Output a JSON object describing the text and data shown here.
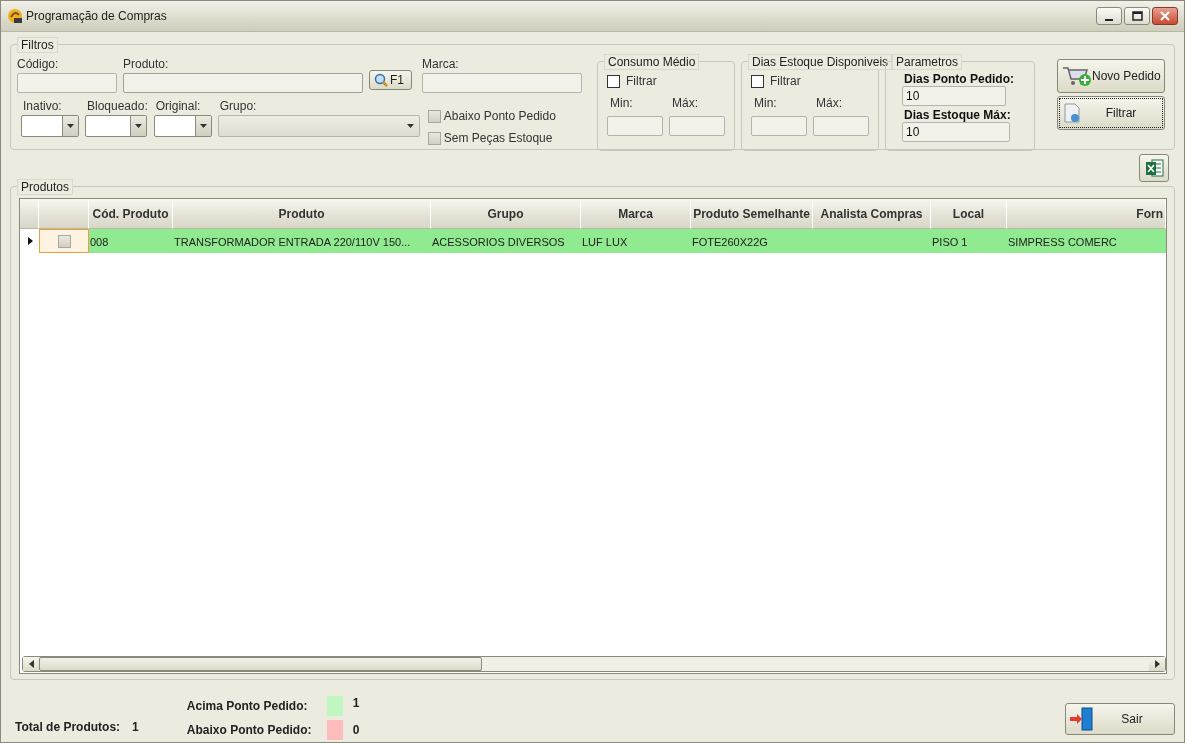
{
  "window": {
    "title": "Programação de Compras"
  },
  "filters": {
    "title": "Filtros",
    "text_fields": [
      {
        "label": "Código:"
      },
      {
        "label": "Produto:"
      },
      {
        "label": "Marca:"
      }
    ],
    "lookup_button": "F1",
    "combos": [
      {
        "label": "Inativo:"
      },
      {
        "label": "Bloqueado:"
      },
      {
        "label": "Original:"
      },
      {
        "label": "Grupo:"
      }
    ],
    "checkboxes": [
      {
        "label": "Abaixo Ponto Pedido",
        "checked": false
      },
      {
        "label": "Sem Peças Estoque",
        "checked": false
      }
    ]
  },
  "ranges": [
    {
      "title": "Consumo Médio",
      "filter_label": "Filtrar",
      "checked": false,
      "min_label": "Min:",
      "max_label": "Máx:"
    },
    {
      "title": "Dias Estoque Disponiveis",
      "filter_label": "Filtrar",
      "checked": false,
      "min_label": "Min:",
      "max_label": "Máx:"
    }
  ],
  "parametros": {
    "title": "Parametros",
    "fields": [
      {
        "label": "Dias Ponto Pedido:",
        "value": "10"
      },
      {
        "label": "Dias Estoque Máx:",
        "value": "10"
      }
    ]
  },
  "actions": [
    {
      "kind": "new",
      "label": "Novo Pedido"
    },
    {
      "kind": "filter",
      "label": "Filtrar"
    }
  ],
  "products": {
    "title": "Produtos",
    "columns": [
      "Cód. Produto",
      "Produto",
      "Grupo",
      "Marca",
      "Produto Semelhante",
      "Analista Compras",
      "Local",
      "Forn"
    ],
    "rows": [
      {
        "selected": true,
        "checked": false,
        "color": "#90ea90",
        "cells": [
          "008",
          "TRANSFORMADOR  ENTRADA  220/110V  150...",
          "ACESSORIOS DIVERSOS",
          "LUF LUX",
          "FOTE260X22G",
          null,
          "PISO 1",
          "SIMPRESS  COMERC"
        ]
      }
    ]
  },
  "footer": {
    "total_label": "Total de Produtos:",
    "total": "1",
    "legend": [
      {
        "label": "Acima Ponto Pedido:",
        "color": "#c0f7c0",
        "count": "1"
      },
      {
        "label": "Abaixo Ponto Pedido:",
        "color": "#ffbcbc",
        "count": "0"
      }
    ],
    "exit_button": "Sair"
  }
}
